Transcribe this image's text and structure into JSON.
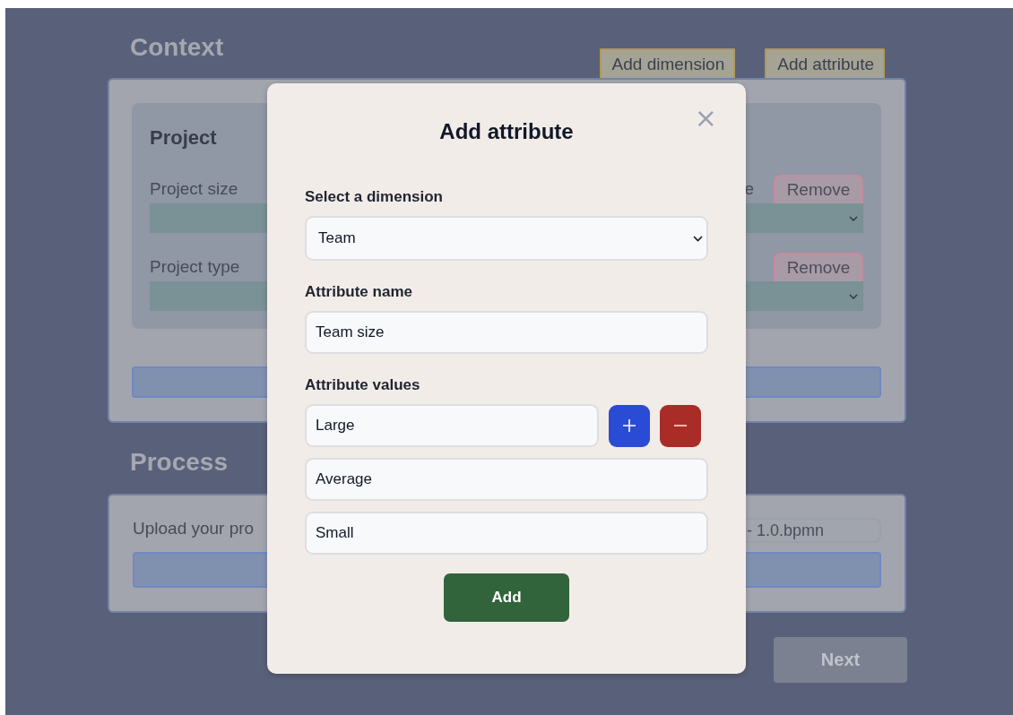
{
  "context": {
    "title": "Context",
    "buttons": [
      {
        "label": "Add dimension"
      },
      {
        "label": "Add attribute"
      }
    ],
    "group": {
      "title": "Project",
      "rows": [
        {
          "column_1": {
            "label": "Project size"
          },
          "column_2": {
            "label": "e",
            "button": "Remove"
          }
        },
        {
          "column_1": {
            "label": "Project type"
          },
          "column_2": {
            "button": "Remove"
          }
        }
      ]
    }
  },
  "process": {
    "title": "Process",
    "upload_label": "Upload your pro",
    "file_name": "- 1.0.bpmn"
  },
  "next_button": {
    "label": "Next",
    "disabled": true
  },
  "modal": {
    "title": "Add attribute",
    "close": "×",
    "fields": [
      {
        "kind": "select",
        "label": "Select a dimension",
        "value": "Team"
      },
      {
        "kind": "text",
        "label": "Attribute name",
        "value": "Team size"
      }
    ],
    "values_label": "Attribute values",
    "values": [
      "Large",
      "Average",
      "Small"
    ],
    "add_button": "Add"
  }
}
